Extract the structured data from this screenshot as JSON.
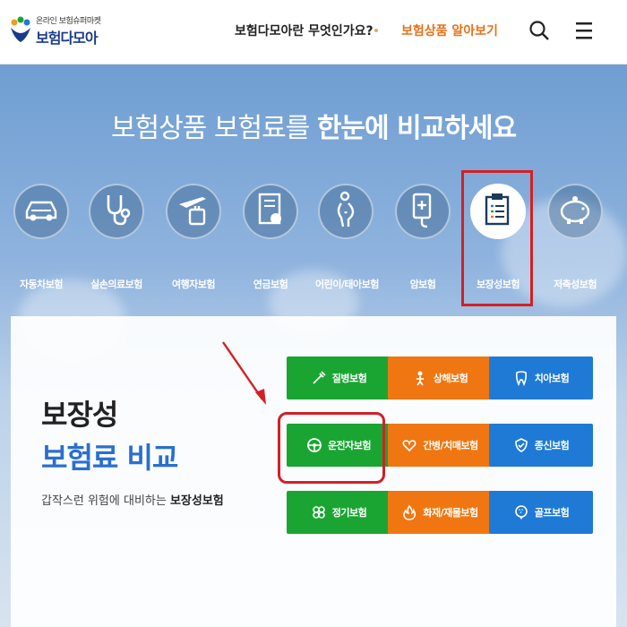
{
  "header": {
    "logo_sub": "온라인 보험슈퍼마켓",
    "logo_main": "보험다모아",
    "nav_what": "보험다모아란 무엇인가요?",
    "nav_products": "보험상품 알아보기",
    "search_icon": "search-icon",
    "menu_icon": "hamburger-menu-icon"
  },
  "hero": {
    "title_pre": "보험상품 보험료를 ",
    "title_bold": "한눈에 비교하세요"
  },
  "categories": [
    {
      "label": "자동차보험",
      "icon": "car-icon"
    },
    {
      "label": "실손의료보험",
      "icon": "stethoscope-icon"
    },
    {
      "label": "여행자보험",
      "icon": "airplane-luggage-icon"
    },
    {
      "label": "연금보험",
      "icon": "pension-document-icon"
    },
    {
      "label": "어린이/태아보험",
      "icon": "pregnant-icon"
    },
    {
      "label": "암보험",
      "icon": "medical-drip-icon"
    },
    {
      "label": "보장성보험",
      "icon": "clipboard-icon",
      "active": true
    },
    {
      "label": "저축성보험",
      "icon": "piggy-bank-icon"
    }
  ],
  "panel": {
    "title1": "보장성",
    "title2": "보험료 비교",
    "desc_pre": "갑작스런 위험에 대비하는 ",
    "desc_bold": "보장성보험"
  },
  "products": [
    {
      "label": "질병보험",
      "icon": "syringe-icon",
      "color": "#1aa532"
    },
    {
      "label": "상해보험",
      "icon": "injury-icon",
      "color": "#f07612"
    },
    {
      "label": "치아보험",
      "icon": "tooth-icon",
      "color": "#1f7ad6"
    },
    {
      "label": "운전자보험",
      "icon": "steering-wheel-icon",
      "color": "#1aa532"
    },
    {
      "label": "간병/치매보험",
      "icon": "heart-hand-icon",
      "color": "#f07612"
    },
    {
      "label": "종신보험",
      "icon": "shield-icon",
      "color": "#1f7ad6"
    },
    {
      "label": "정기보험",
      "icon": "clover-icon",
      "color": "#1aa532"
    },
    {
      "label": "화재/재물보험",
      "icon": "fire-icon",
      "color": "#f07612"
    },
    {
      "label": "골프보험",
      "icon": "golf-icon",
      "color": "#1f7ad6"
    }
  ]
}
